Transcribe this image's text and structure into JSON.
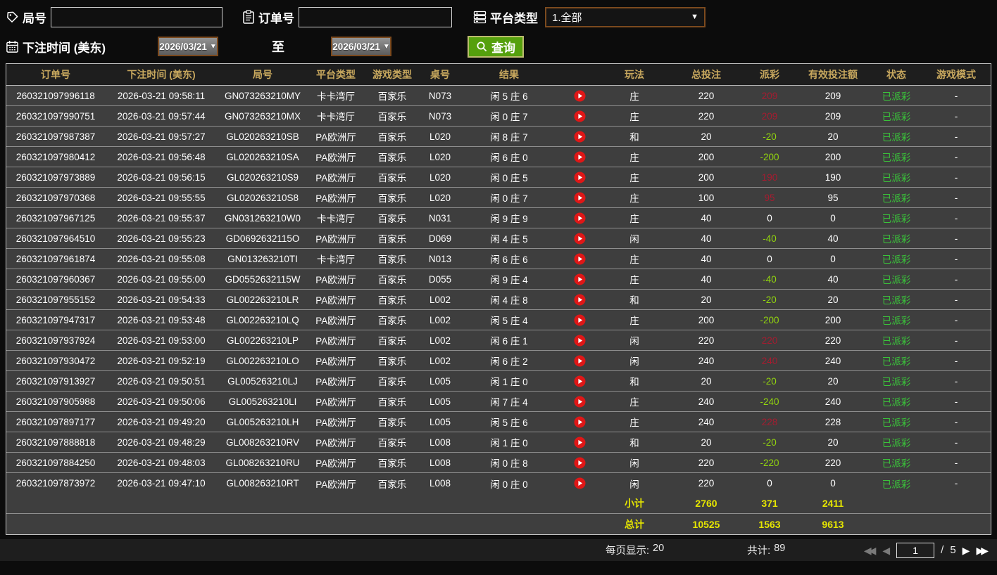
{
  "filters": {
    "round_label": "局号",
    "order_label": "订单号",
    "platform_label": "平台类型",
    "platform_value": "1.全部",
    "bet_time_label": "下注时间 (美东)",
    "date_from": "2026/03/21",
    "date_to": "2026/03/21",
    "to_label": "至",
    "search_label": "查询"
  },
  "colors": {
    "payout_win": "#a51c30",
    "payout_loss": "#92d50e",
    "status_green": "#3ac43a",
    "summary_yellow": "#e6e600",
    "header_gold": "#c8a85e",
    "search_green": "#55a00d"
  },
  "table": {
    "headers": [
      "订单号",
      "下注时间 (美东)",
      "局号",
      "平台类型",
      "游戏类型",
      "桌号",
      "结果",
      "玩法",
      "总投注",
      "派彩",
      "有效投注额",
      "状态",
      "游戏模式"
    ],
    "rows": [
      {
        "order": "260321097996118",
        "time": "2026-03-21 09:58:11",
        "round": "GN073263210MY",
        "platform": "卡卡湾厅",
        "game": "百家乐",
        "table": "N073",
        "result": "闲 5 庄 6",
        "playtype": "庄",
        "bet": "220",
        "payout": "209",
        "valid": "209",
        "status": "已派彩",
        "mode": "-"
      },
      {
        "order": "260321097990751",
        "time": "2026-03-21 09:57:44",
        "round": "GN073263210MX",
        "platform": "卡卡湾厅",
        "game": "百家乐",
        "table": "N073",
        "result": "闲 0 庄 7",
        "playtype": "庄",
        "bet": "220",
        "payout": "209",
        "valid": "209",
        "status": "已派彩",
        "mode": "-"
      },
      {
        "order": "260321097987387",
        "time": "2026-03-21 09:57:27",
        "round": "GL020263210SB",
        "platform": "PA欧洲厅",
        "game": "百家乐",
        "table": "L020",
        "result": "闲 8 庄 7",
        "playtype": "和",
        "bet": "20",
        "payout": "-20",
        "valid": "20",
        "status": "已派彩",
        "mode": "-"
      },
      {
        "order": "260321097980412",
        "time": "2026-03-21 09:56:48",
        "round": "GL020263210SA",
        "platform": "PA欧洲厅",
        "game": "百家乐",
        "table": "L020",
        "result": "闲 6 庄 0",
        "playtype": "庄",
        "bet": "200",
        "payout": "-200",
        "valid": "200",
        "status": "已派彩",
        "mode": "-"
      },
      {
        "order": "260321097973889",
        "time": "2026-03-21 09:56:15",
        "round": "GL020263210S9",
        "platform": "PA欧洲厅",
        "game": "百家乐",
        "table": "L020",
        "result": "闲 0 庄 5",
        "playtype": "庄",
        "bet": "200",
        "payout": "190",
        "valid": "190",
        "status": "已派彩",
        "mode": "-"
      },
      {
        "order": "260321097970368",
        "time": "2026-03-21 09:55:55",
        "round": "GL020263210S8",
        "platform": "PA欧洲厅",
        "game": "百家乐",
        "table": "L020",
        "result": "闲 0 庄 7",
        "playtype": "庄",
        "bet": "100",
        "payout": "95",
        "valid": "95",
        "status": "已派彩",
        "mode": "-"
      },
      {
        "order": "260321097967125",
        "time": "2026-03-21 09:55:37",
        "round": "GN031263210W0",
        "platform": "卡卡湾厅",
        "game": "百家乐",
        "table": "N031",
        "result": "闲 9 庄 9",
        "playtype": "庄",
        "bet": "40",
        "payout": "0",
        "valid": "0",
        "status": "已派彩",
        "mode": "-"
      },
      {
        "order": "260321097964510",
        "time": "2026-03-21 09:55:23",
        "round": "GD0692632115O",
        "platform": "PA欧洲厅",
        "game": "百家乐",
        "table": "D069",
        "result": "闲 4 庄 5",
        "playtype": "闲",
        "bet": "40",
        "payout": "-40",
        "valid": "40",
        "status": "已派彩",
        "mode": "-"
      },
      {
        "order": "260321097961874",
        "time": "2026-03-21 09:55:08",
        "round": "GN013263210TI",
        "platform": "卡卡湾厅",
        "game": "百家乐",
        "table": "N013",
        "result": "闲 6 庄 6",
        "playtype": "庄",
        "bet": "40",
        "payout": "0",
        "valid": "0",
        "status": "已派彩",
        "mode": "-"
      },
      {
        "order": "260321097960367",
        "time": "2026-03-21 09:55:00",
        "round": "GD0552632115W",
        "platform": "PA欧洲厅",
        "game": "百家乐",
        "table": "D055",
        "result": "闲 9 庄 4",
        "playtype": "庄",
        "bet": "40",
        "payout": "-40",
        "valid": "40",
        "status": "已派彩",
        "mode": "-"
      },
      {
        "order": "260321097955152",
        "time": "2026-03-21 09:54:33",
        "round": "GL002263210LR",
        "platform": "PA欧洲厅",
        "game": "百家乐",
        "table": "L002",
        "result": "闲 4 庄 8",
        "playtype": "和",
        "bet": "20",
        "payout": "-20",
        "valid": "20",
        "status": "已派彩",
        "mode": "-"
      },
      {
        "order": "260321097947317",
        "time": "2026-03-21 09:53:48",
        "round": "GL002263210LQ",
        "platform": "PA欧洲厅",
        "game": "百家乐",
        "table": "L002",
        "result": "闲 5 庄 4",
        "playtype": "庄",
        "bet": "200",
        "payout": "-200",
        "valid": "200",
        "status": "已派彩",
        "mode": "-"
      },
      {
        "order": "260321097937924",
        "time": "2026-03-21 09:53:00",
        "round": "GL002263210LP",
        "platform": "PA欧洲厅",
        "game": "百家乐",
        "table": "L002",
        "result": "闲 6 庄 1",
        "playtype": "闲",
        "bet": "220",
        "payout": "220",
        "valid": "220",
        "status": "已派彩",
        "mode": "-"
      },
      {
        "order": "260321097930472",
        "time": "2026-03-21 09:52:19",
        "round": "GL002263210LO",
        "platform": "PA欧洲厅",
        "game": "百家乐",
        "table": "L002",
        "result": "闲 6 庄 2",
        "playtype": "闲",
        "bet": "240",
        "payout": "240",
        "valid": "240",
        "status": "已派彩",
        "mode": "-"
      },
      {
        "order": "260321097913927",
        "time": "2026-03-21 09:50:51",
        "round": "GL005263210LJ",
        "platform": "PA欧洲厅",
        "game": "百家乐",
        "table": "L005",
        "result": "闲 1 庄 0",
        "playtype": "和",
        "bet": "20",
        "payout": "-20",
        "valid": "20",
        "status": "已派彩",
        "mode": "-"
      },
      {
        "order": "260321097905988",
        "time": "2026-03-21 09:50:06",
        "round": "GL005263210LI",
        "platform": "PA欧洲厅",
        "game": "百家乐",
        "table": "L005",
        "result": "闲 7 庄 4",
        "playtype": "庄",
        "bet": "240",
        "payout": "-240",
        "valid": "240",
        "status": "已派彩",
        "mode": "-"
      },
      {
        "order": "260321097897177",
        "time": "2026-03-21 09:49:20",
        "round": "GL005263210LH",
        "platform": "PA欧洲厅",
        "game": "百家乐",
        "table": "L005",
        "result": "闲 5 庄 6",
        "playtype": "庄",
        "bet": "240",
        "payout": "228",
        "valid": "228",
        "status": "已派彩",
        "mode": "-"
      },
      {
        "order": "260321097888818",
        "time": "2026-03-21 09:48:29",
        "round": "GL008263210RV",
        "platform": "PA欧洲厅",
        "game": "百家乐",
        "table": "L008",
        "result": "闲 1 庄 0",
        "playtype": "和",
        "bet": "20",
        "payout": "-20",
        "valid": "20",
        "status": "已派彩",
        "mode": "-"
      },
      {
        "order": "260321097884250",
        "time": "2026-03-21 09:48:03",
        "round": "GL008263210RU",
        "platform": "PA欧洲厅",
        "game": "百家乐",
        "table": "L008",
        "result": "闲 0 庄 8",
        "playtype": "闲",
        "bet": "220",
        "payout": "-220",
        "valid": "220",
        "status": "已派彩",
        "mode": "-"
      },
      {
        "order": "260321097873972",
        "time": "2026-03-21 09:47:10",
        "round": "GL008263210RT",
        "platform": "PA欧洲厅",
        "game": "百家乐",
        "table": "L008",
        "result": "闲 0 庄 0",
        "playtype": "闲",
        "bet": "220",
        "payout": "0",
        "valid": "0",
        "status": "已派彩",
        "mode": "-"
      }
    ],
    "subtotal": {
      "label": "小计",
      "bet": "2760",
      "payout": "371",
      "valid": "2411"
    },
    "total": {
      "label": "总计",
      "bet": "10525",
      "payout": "1563",
      "valid": "9613"
    }
  },
  "footer": {
    "page_size_label": "每页显示:",
    "page_size_value": "20",
    "total_count_label": "共计:",
    "total_count_value": "89",
    "current_page": "1",
    "page_separator": "/",
    "total_pages": "5"
  }
}
